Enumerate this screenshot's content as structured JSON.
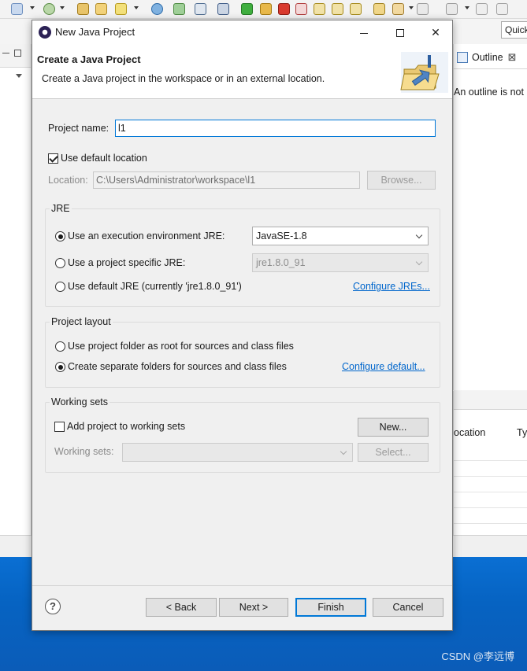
{
  "ide": {
    "quick_access": "Quick",
    "outline_tab": "Outline",
    "outline_message": "An outline is not",
    "bottom_headers": [
      "ocation",
      "Ty"
    ]
  },
  "dialog": {
    "title": "New Java Project",
    "banner_title": "Create a Java Project",
    "banner_description": "Create a Java project in the workspace or in an external location.",
    "project_name_label": "Project name:",
    "project_name_value": "l1",
    "use_default_location_label": "Use default location",
    "use_default_location_checked": true,
    "location_label": "Location:",
    "location_value": "C:\\Users\\Administrator\\workspace\\l1",
    "browse_button": "Browse...",
    "jre": {
      "title": "JRE",
      "option_env": "Use an execution environment JRE:",
      "env_value": "JavaSE-1.8",
      "option_specific": "Use a project specific JRE:",
      "specific_value": "jre1.8.0_91",
      "option_default": "Use default JRE (currently 'jre1.8.0_91')",
      "configure_link": "Configure JREs...",
      "selected": "env"
    },
    "layout": {
      "title": "Project layout",
      "option_root": "Use project folder as root for sources and class files",
      "option_separate": "Create separate folders for sources and class files",
      "configure_link": "Configure default...",
      "selected": "separate"
    },
    "working_sets": {
      "title": "Working sets",
      "add_label": "Add project to working sets",
      "add_checked": false,
      "new_button": "New...",
      "sets_label": "Working sets:",
      "sets_value": "",
      "select_button": "Select..."
    },
    "footer": {
      "help": "?",
      "back": "< Back",
      "next": "Next >",
      "finish": "Finish",
      "cancel": "Cancel"
    }
  },
  "watermark": "CSDN @李远博",
  "colors": {
    "accent": "#0078d7",
    "link": "#0066cc",
    "desktop": "#0663c2"
  }
}
